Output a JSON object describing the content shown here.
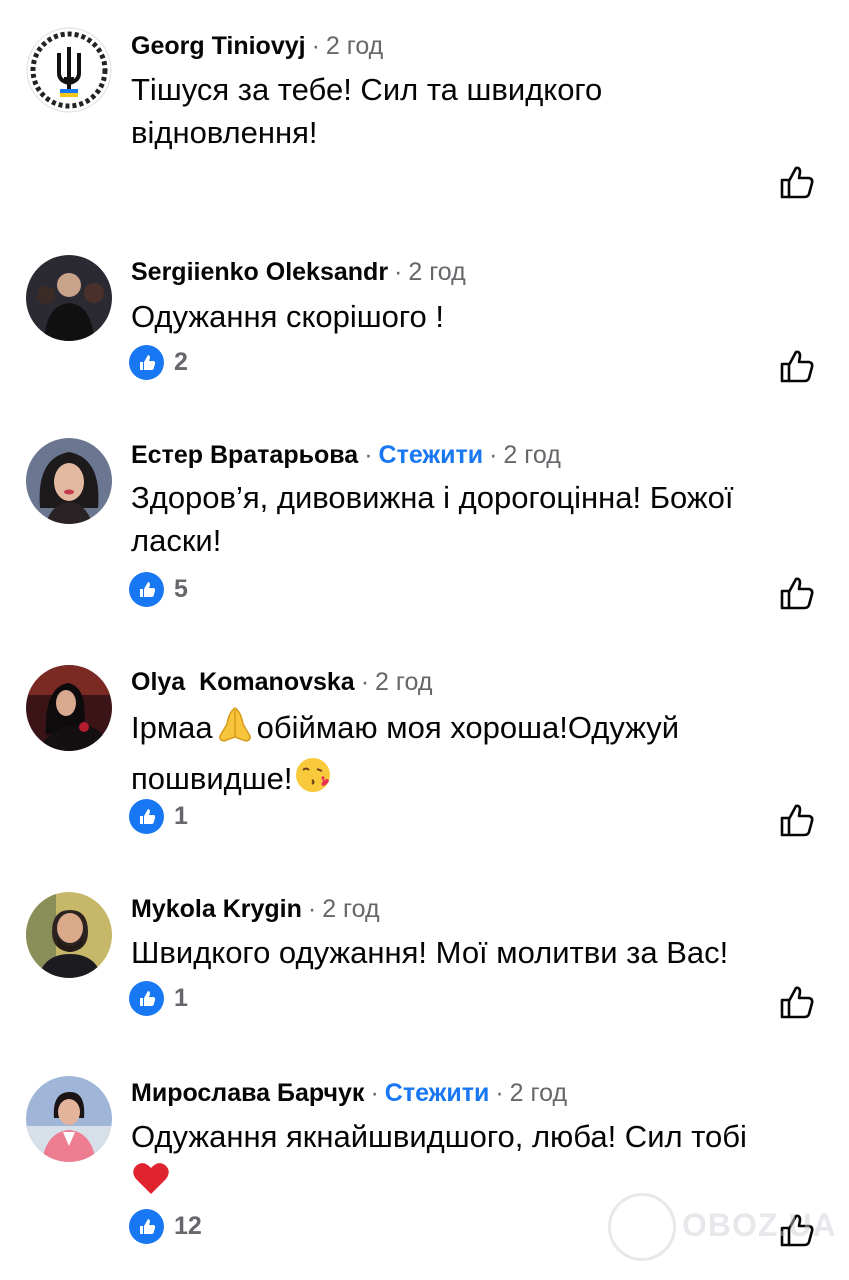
{
  "comments": [
    {
      "author": "Georg Tiniovyj",
      "follow": "",
      "time": "2 год",
      "text_lines": [
        "Тішуся за тебе! Сил та швидкого",
        "відновлення!"
      ],
      "likes": null,
      "avatar_icon": "trident-emblem-avatar"
    },
    {
      "author": "Sergiienko Oleksandr",
      "follow": "",
      "time": "2 год",
      "text_lines": [
        "Одужання скорішого !"
      ],
      "likes": "2",
      "avatar_icon": "profile-photo-avatar"
    },
    {
      "author": "Естер Вратарьова",
      "follow": "Стежити",
      "time": "2 год",
      "text_lines": [
        "Здоров’я, дивовижна і дорогоцінна! Божої",
        "ласки!"
      ],
      "likes": "5",
      "avatar_icon": "profile-photo-avatar"
    },
    {
      "author": "Olya  Komanovska",
      "follow": "",
      "time": "2 год",
      "text_lines": [
        "Ірмаа",
        "обіймаю моя хороша!Одужуй",
        "пошвидше!"
      ],
      "likes": "1",
      "avatar_icon": "profile-photo-avatar"
    },
    {
      "author": "Mykola Krygin",
      "follow": "",
      "time": "2 год",
      "text_lines": [
        "Швидкого одужання! Мої молитви за Вас!"
      ],
      "likes": "1",
      "avatar_icon": "profile-photo-avatar"
    },
    {
      "author": "Мирослава Барчук",
      "follow": "Стежити",
      "time": "2 год",
      "text_lines": [
        "Одужання якнайшвидшого, люба! Сил тобі"
      ],
      "likes": "12",
      "avatar_icon": "profile-photo-avatar"
    }
  ],
  "separator": "·",
  "watermark": {
    "text": "OBOZ.UA"
  },
  "colors": {
    "accent": "#1877f2",
    "secondary_text": "#65676b",
    "primary_text": "#050505",
    "background": "#ffffff"
  },
  "icons": {
    "like_badge": "thumbs-up-icon",
    "like_action": "thumbs-up-outline-icon",
    "emoji_pray": "folded-hands-icon",
    "emoji_kiss": "face-blowing-kiss-icon",
    "emoji_heart": "red-heart-icon"
  }
}
